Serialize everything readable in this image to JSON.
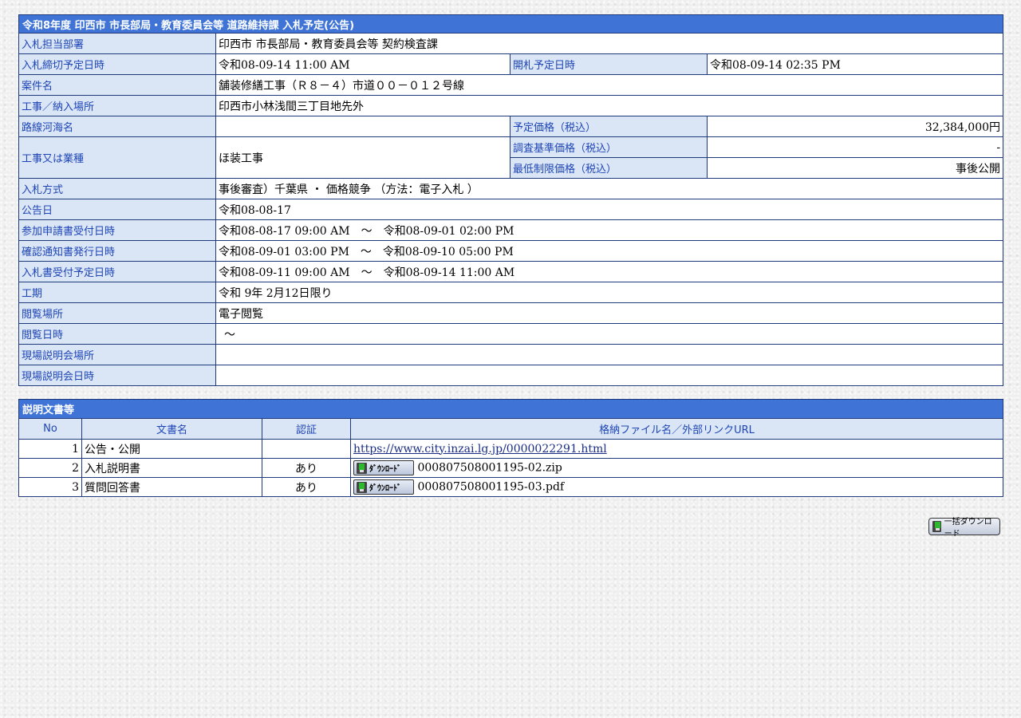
{
  "bid_info": {
    "title": "令和8年度 印西市 市長部局・教育委員会等 道路維持課 入札予定(公告)",
    "rows": {
      "dept": {
        "label": "入札担当部署",
        "value": "印西市 市長部局・教育委員会等 契約検査課"
      },
      "deadline": {
        "label": "入札締切予定日時",
        "value": "令和08-09-14 11:00 AM"
      },
      "opening": {
        "label": "開札予定日時",
        "value": "令和08-09-14 02:35 PM"
      },
      "case_name": {
        "label": "案件名",
        "value": "舗装修繕工事（Ｒ８－４）市道００－０１２号線"
      },
      "place": {
        "label": "工事／納入場所",
        "value": "印西市小林浅間三丁目地先外"
      },
      "route": {
        "label": "路線河海名",
        "value": ""
      },
      "est_price": {
        "label": "予定価格（税込）",
        "value": "32,384,000円"
      },
      "category": {
        "label": "工事又は業種",
        "value": "ほ装工事"
      },
      "survey_price": {
        "label": "調査基準価格（税込）",
        "value": "-"
      },
      "min_price": {
        "label": "最低制限価格（税込）",
        "value": "事後公開"
      },
      "method": {
        "label": "入札方式",
        "value": "事後審査）千葉県 ・ 価格競争 （方法：電子入札 ）"
      },
      "notice_date": {
        "label": "公告日",
        "value": "令和08-08-17"
      },
      "apply_period": {
        "label": "参加申請書受付日時",
        "value": "令和08-08-17 09:00 AM　～　令和08-09-01 02:00 PM"
      },
      "confirm_period": {
        "label": "確認通知書発行日時",
        "value": "令和08-09-01 03:00 PM　～　令和08-09-10 05:00 PM"
      },
      "bid_period": {
        "label": "入札書受付予定日時",
        "value": "令和08-09-11 09:00 AM　～　令和08-09-14 11:00 AM"
      },
      "term": {
        "label": "工期",
        "value": "令和 9年 2月12日限り"
      },
      "view_place": {
        "label": "閲覧場所",
        "value": "電子閲覧"
      },
      "view_date": {
        "label": "閲覧日時",
        "value": "～"
      },
      "site_place": {
        "label": "現場説明会場所",
        "value": ""
      },
      "site_date": {
        "label": "現場説明会日時",
        "value": ""
      }
    }
  },
  "docs": {
    "title": "説明文書等",
    "headers": {
      "no": "No",
      "name": "文書名",
      "auth": "認証",
      "file": "格納ファイル名／外部リンクURL"
    },
    "items": [
      {
        "no": "1",
        "name": "公告・公開",
        "auth": "",
        "link": "https://www.city.inzai.lg.jp/0000022291.html"
      },
      {
        "no": "2",
        "name": "入札説明書",
        "auth": "あり",
        "button": "ﾀﾞｳﾝﾛｰﾄﾞ",
        "file": "000807508001195-02.zip"
      },
      {
        "no": "3",
        "name": "質問回答書",
        "auth": "あり",
        "button": "ﾀﾞｳﾝﾛｰﾄﾞ",
        "file": "000807508001195-03.pdf"
      }
    ]
  },
  "bulk_download": {
    "label": "一括ダウンロード",
    "icon": "download-icon"
  }
}
